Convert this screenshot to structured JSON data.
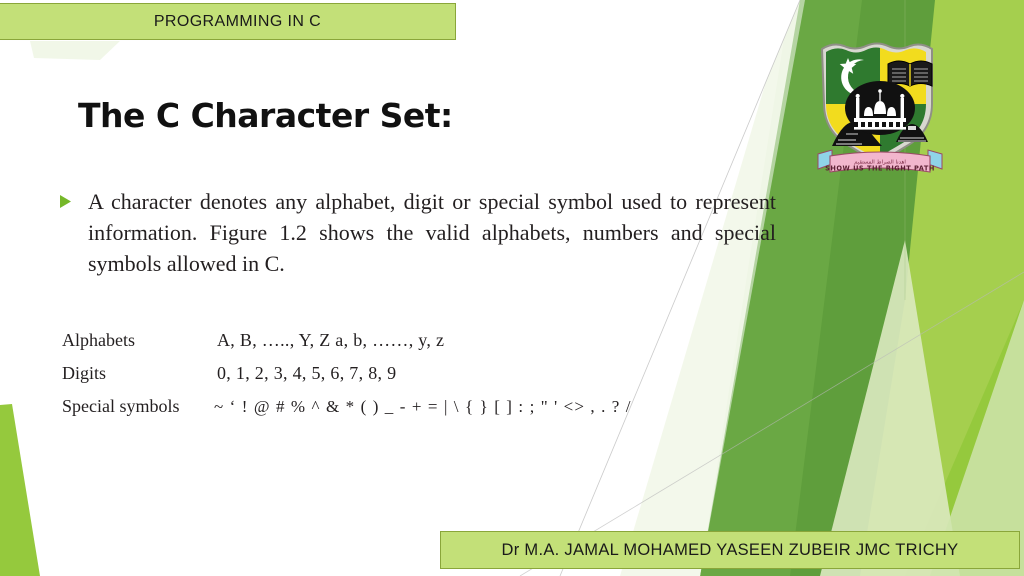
{
  "slide": {
    "title_bar": {
      "label": "PROGRAMMING IN C"
    },
    "heading": "The C Character Set:",
    "bullet": {
      "marker": "triangle-bullet-icon",
      "text": "A character denotes any alphabet, digit or special symbol used to represent information. Figure 1.2 shows the valid alphabets, numbers and special symbols allowed in C."
    },
    "character_set": {
      "rows": [
        {
          "label": "Alphabets",
          "value": "A, B, ….., Y, Z a, b, ……, y, z"
        },
        {
          "label": "Digits",
          "value": "0, 1, 2, 3, 4, 5, 6, 7, 8, 9"
        },
        {
          "label": "Special symbols",
          "value": "~ ‘ ! @ # % ^ & * ( ) _ - + = | \\ { } [ ] : ; \" ' <> , . ? /"
        }
      ]
    },
    "footer_bar": {
      "label": "Dr  M.A.  JAMAL MOHAMED YASEEN ZUBEIR JMC TRICHY"
    },
    "crest": {
      "name": "jamal-mohamed-college-crest",
      "motto": "SHOW US THE RIGHT PATH",
      "motto_arabic": "اهدنا الصراط المستقيم"
    },
    "colors": {
      "bar_fill": "#c3e078",
      "bar_border": "#8aa63a",
      "bullet_green": "#76b82a",
      "bg_green_bright": "#95c93d",
      "bg_green_mid": "#6aa844",
      "bg_green_dark": "#4f8f3a",
      "bg_green_pale": "#dbe9c0",
      "body_text": "#231f20"
    }
  }
}
